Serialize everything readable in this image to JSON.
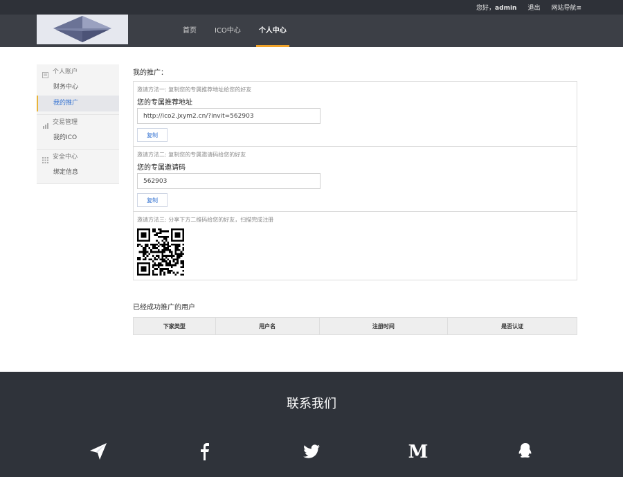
{
  "topbar": {
    "greeting_prefix": "您好，",
    "username": "admin",
    "logout": "退出",
    "site_nav": "网站导航≡"
  },
  "nav": {
    "items": [
      {
        "label": "首页"
      },
      {
        "label": "ICO中心"
      },
      {
        "label": "个人中心"
      }
    ],
    "active_index": 2
  },
  "sidebar": {
    "groups": [
      {
        "title": "个人账户",
        "icon": "document-icon",
        "items": [
          "财务中心",
          "我的推广"
        ]
      },
      {
        "title": "交易管理",
        "icon": "bar-chart-icon",
        "items": [
          "我的ICO"
        ]
      },
      {
        "title": "安全中心",
        "icon": "grid-icon",
        "items": [
          "绑定信息"
        ]
      }
    ],
    "active_item": "我的推广"
  },
  "main": {
    "title": "我的推广：",
    "method1": {
      "hint": "邀请方法一: 复制您的专属推荐地址给您的好友",
      "label": "您的专属推荐地址",
      "value": "http://ico2.jxym2.cn/?invit=562903",
      "copy": "复制"
    },
    "method2": {
      "hint": "邀请方法二: 复制您的专属邀请码给您的好友",
      "label": "您的专属邀请码",
      "value": "562903",
      "copy": "复制"
    },
    "method3": {
      "hint": "邀请方法三: 分享下方二维码给您的好友，扫描完成注册"
    },
    "referred_title": "已经成功推广的用户",
    "table_headers": [
      "下家类型",
      "用户名",
      "注册时间",
      "是否认证"
    ]
  },
  "footer": {
    "title": "联系我们",
    "socials": [
      "telegram-icon",
      "facebook-icon",
      "twitter-icon",
      "medium-icon",
      "qq-icon"
    ]
  },
  "colors": {
    "accent": "#f0a32a",
    "link": "#2f6fd1",
    "dark": "#2f333a"
  }
}
